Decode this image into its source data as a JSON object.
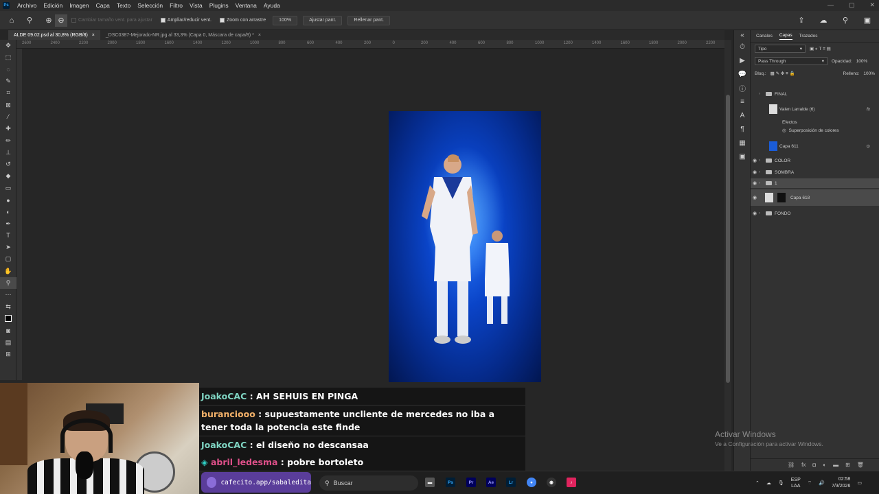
{
  "menubar": {
    "logo": "Ps",
    "items": [
      "Archivo",
      "Edición",
      "Imagen",
      "Capa",
      "Texto",
      "Selección",
      "Filtro",
      "Vista",
      "Plugins",
      "Ventana",
      "Ayuda"
    ],
    "win_controls": [
      "—",
      "▢",
      "✕"
    ]
  },
  "options": {
    "resize_windows": "Cambiar tamaño vent. para ajustar",
    "zoom_all": "Ampliar/reducir vent.",
    "scrubby": "Zoom con arrastre",
    "zoom_value": "100%",
    "fit_screen": "Ajustar pant.",
    "fill_screen": "Rellenar pant."
  },
  "tabs": [
    {
      "label": "ALDE 09.02.psd al 30,8% (RGB/8)",
      "close": "×"
    },
    {
      "label": "_DSC0387-Mejorado-NR.jpg al 33,3% (Capa 0, Máscara de capa/8) *",
      "close": "×"
    }
  ],
  "ruler": [
    "2600",
    "2400",
    "2200",
    "2000",
    "1800",
    "1600",
    "1400",
    "1200",
    "1000",
    "800",
    "600",
    "400",
    "200",
    "0",
    "200",
    "400",
    "600",
    "800",
    "1000",
    "1200",
    "1400",
    "1600",
    "1800",
    "2000",
    "2200"
  ],
  "panel": {
    "tabs": [
      "Canales",
      "Capas",
      "Trazados"
    ],
    "filter_label": "Tipo",
    "blend_mode": "Pass Through",
    "opacity_label": "Opacidad:",
    "opacity_value": "100%",
    "lock_label": "Bloq.:",
    "fill_label": "Relleno:",
    "fill_value": "100%",
    "layers": {
      "final": "FINAL",
      "valen": "Valen Larralde (6)",
      "fx": "fx",
      "efectos": "Efectos",
      "superposicion": "Superposición de colores",
      "capa611": "Capa 611",
      "color": "COLOR",
      "sombra": "SOMBRA",
      "one": "1",
      "capa618": "Capa 618",
      "fondo": "FONDO"
    }
  },
  "activate_windows": {
    "title": "Activar Windows",
    "subtitle": "Ve a Configuración para activar Windows."
  },
  "chat": [
    {
      "user": "JoakoCAC",
      "color": "#7fd4c2",
      "text": " : AH SEHUIS EN PINGA"
    },
    {
      "user": "buranciooo",
      "color": "#f4b26a",
      "text": " : supuestamente uncliente de mercedes no iba a tener toda la potencia este finde"
    },
    {
      "user": "JoakoCAC",
      "color": "#7fd4c2",
      "text": " : el diseño no descansaa"
    },
    {
      "user": "abril_ledesma",
      "color": "#e0508a",
      "text": " : pobre bortoleto"
    }
  ],
  "taskbar": {
    "cafecito": "cafecito.app/sabaledita",
    "search_placeholder": "Buscar",
    "lang_line1": "ESP",
    "lang_line2": "LAA",
    "time": "02:58",
    "date": "7/3/2026"
  },
  "colors": {
    "accent_ps": "#31a8ff",
    "chat_bg": "#141414",
    "cafecito_bg": "#5a3d9a"
  }
}
